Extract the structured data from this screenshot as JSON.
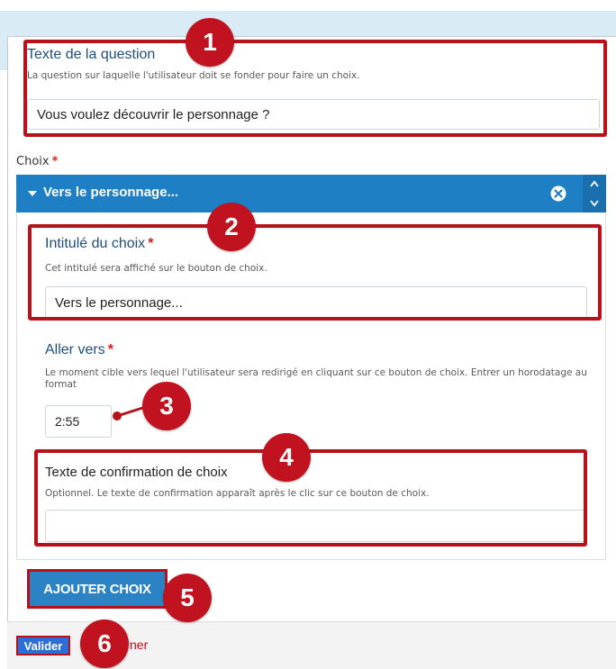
{
  "question": {
    "title": "Texte de la question",
    "description": "La question sur laquelle l'utilisateur doit se fonder pour faire un choix.",
    "value": "Vous voulez découvrir le personnage ?"
  },
  "choices": {
    "label": "Choix",
    "required_mark": "*",
    "items": [
      {
        "header": "Vers le personnage...",
        "label_title": "Intitulé du choix",
        "label_description": "Cet intitulé sera affiché sur le bouton de choix.",
        "label_value": "Vers le personnage...",
        "goto_title": "Aller vers",
        "goto_description": "Le moment cible vers lequel l'utilisateur sera redirigé en cliquant sur ce bouton de choix. Entrer un horodatage au format",
        "goto_value": "2:55",
        "confirm_title": "Texte de confirmation de choix",
        "confirm_description": "Optionnel. Le texte de confirmation apparaît après le clic sur ce bouton de choix.",
        "confirm_value": ""
      }
    ]
  },
  "buttons": {
    "add_choice": "AJOUTER CHOIX",
    "validate": "Valider",
    "cancel": "ner"
  },
  "callouts": [
    "1",
    "2",
    "3",
    "4",
    "5",
    "6"
  ],
  "colors": {
    "highlight": "#b5121b",
    "callout": "#c1121f",
    "accent": "#1f7fc4",
    "title": "#214e7b"
  },
  "icons": {
    "collapse": "chevron-down-icon",
    "remove": "close-circle-icon",
    "reorder": "up-down-arrows-icon"
  }
}
